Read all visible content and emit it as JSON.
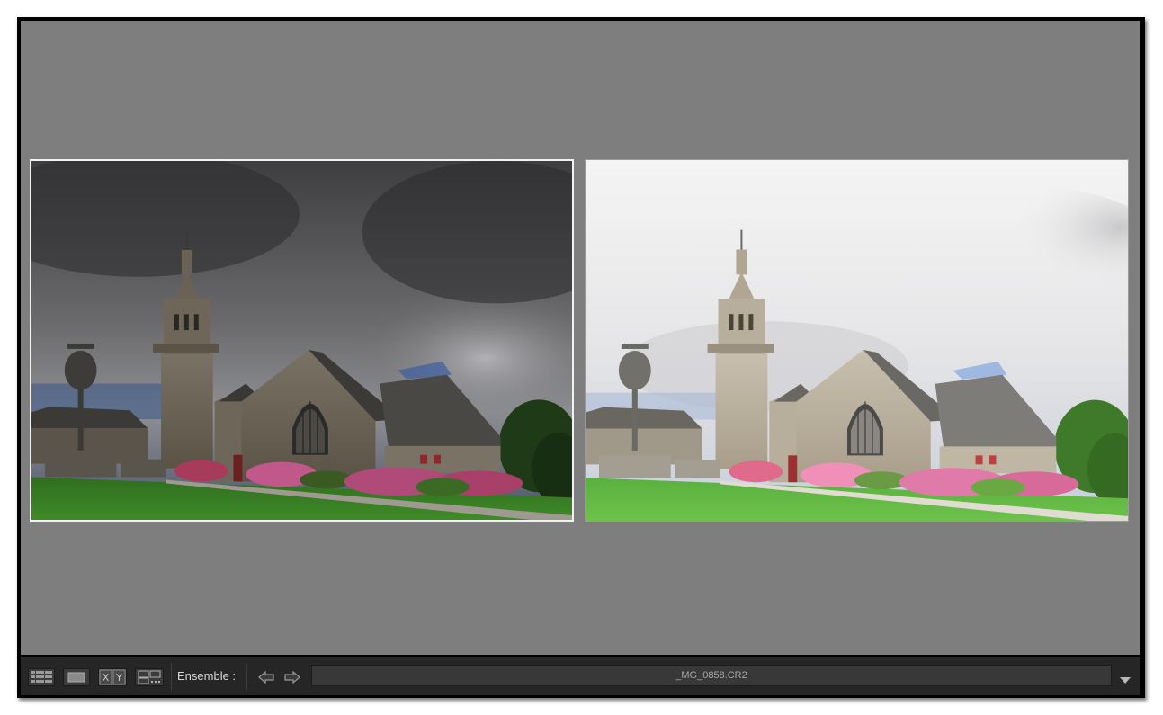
{
  "toolbar": {
    "set_label": "Ensemble :",
    "filename": "_MG_0858.CR2",
    "view_buttons": [
      {
        "name": "grid-view",
        "icon": "grid-icon"
      },
      {
        "name": "loupe-view",
        "icon": "loupe-icon"
      },
      {
        "name": "compare-view",
        "icon": "compare-xy-icon",
        "label": "X Y"
      },
      {
        "name": "survey-view",
        "icon": "survey-icon"
      }
    ],
    "nav": [
      "previous-arrow-icon",
      "next-arrow-icon"
    ]
  },
  "photos": [
    {
      "role": "select",
      "state": "selected",
      "sky": "dark-stormy"
    },
    {
      "role": "candidate",
      "state": "normal",
      "sky": "bright-overcast"
    }
  ],
  "colors": {
    "stage": "#7e7e7e",
    "toolbar": "#262626",
    "grass": "#52a33a",
    "stone": "#8a8070"
  }
}
